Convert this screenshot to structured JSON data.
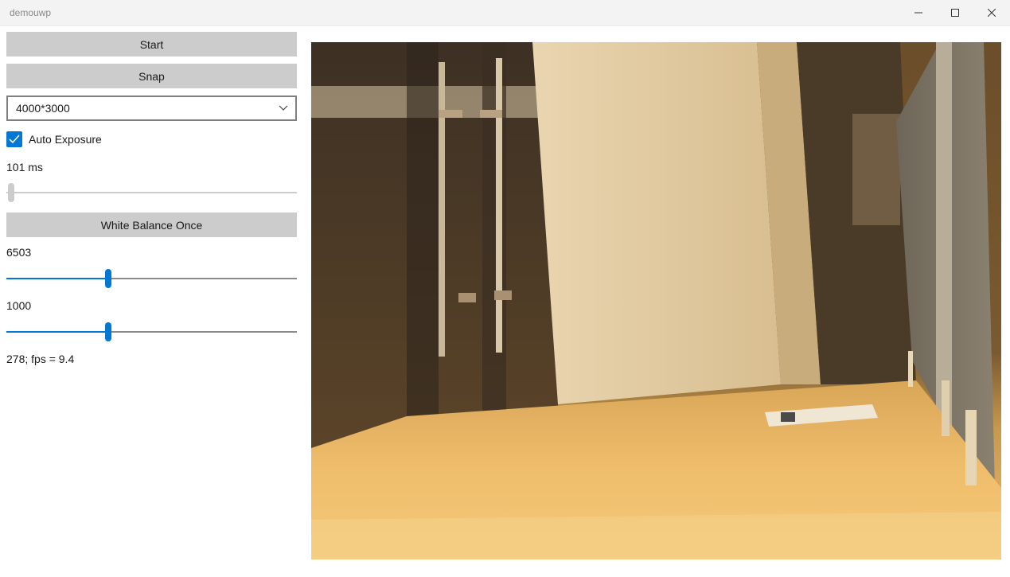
{
  "window": {
    "title": "demouwp",
    "controls": {
      "minimize_icon": "minimize-icon",
      "maximize_icon": "maximize-icon",
      "close_icon": "close-icon"
    }
  },
  "controls": {
    "start_label": "Start",
    "snap_label": "Snap",
    "resolution": {
      "selected": "4000*3000"
    },
    "auto_exposure": {
      "label": "Auto Exposure",
      "checked": true
    },
    "exposure_time": {
      "label": "101 ms",
      "slider_position": 0.0,
      "enabled": false
    },
    "white_balance_label": "White Balance Once",
    "temperature": {
      "label": "6503",
      "slider_position": 0.35
    },
    "tint": {
      "label": "1000",
      "slider_position": 0.35
    },
    "status_text": "278; fps = 9.4"
  },
  "preview": {
    "description_icon": "camera-preview"
  },
  "colors": {
    "accent": "#0078d4",
    "button_bg": "#cccccc",
    "titlebar_bg": "#f3f3f3"
  }
}
